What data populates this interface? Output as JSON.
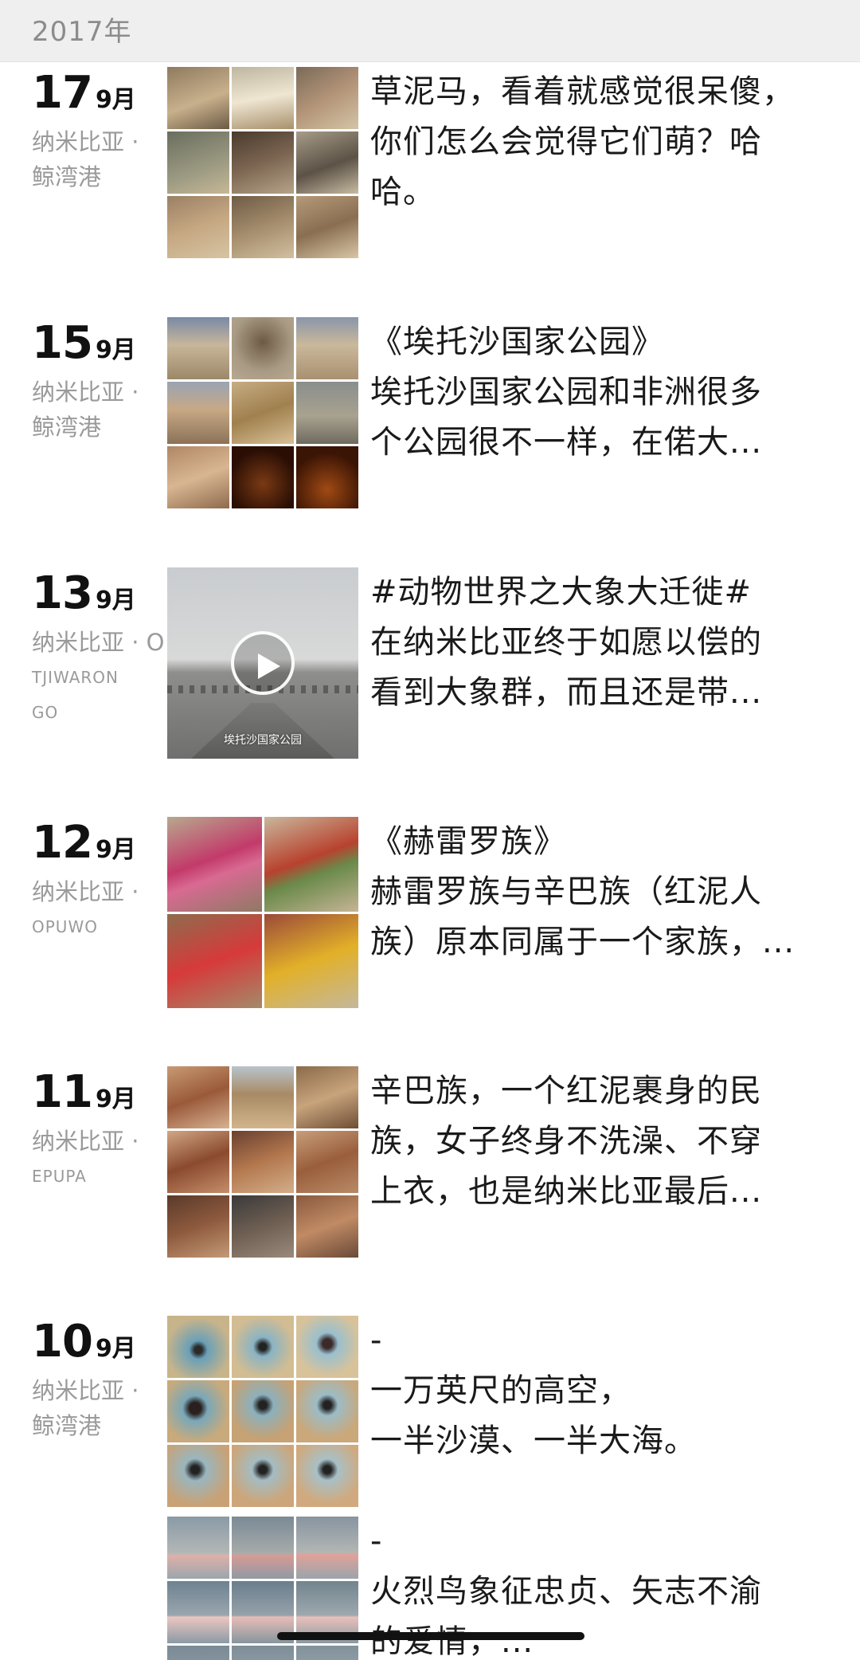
{
  "year_header": "2017年",
  "entries": [
    {
      "day": "17",
      "month": "9月",
      "location": [
        "纳米比亚 ·",
        "鲸湾港"
      ],
      "text": [
        "草泥马，看着就感觉很呆傻，",
        "你们怎么会觉得它们萌？哈",
        "哈。"
      ]
    },
    {
      "day": "15",
      "month": "9月",
      "location": [
        "纳米比亚 ·",
        "鲸湾港"
      ],
      "text": [
        "《埃托沙国家公园》",
        "埃托沙国家公园和非洲很多",
        "个公园很不一样，在偌大..."
      ]
    },
    {
      "day": "13",
      "month": "9月",
      "location": [
        "纳米比亚 · O",
        "TJIWARON",
        "GO"
      ],
      "video_caption": "埃托沙国家公园",
      "text": [
        "#动物世界之大象大迁徙#",
        "在纳米比亚终于如愿以偿的",
        "看到大象群，而且还是带..."
      ]
    },
    {
      "day": "12",
      "month": "9月",
      "location": [
        "纳米比亚 ·",
        "OPUWO"
      ],
      "text": [
        "《赫雷罗族》",
        "赫雷罗族与辛巴族（红泥人",
        "族）原本同属于一个家族，..."
      ]
    },
    {
      "day": "11",
      "month": "9月",
      "location": [
        "纳米比亚 ·",
        "EPUPA"
      ],
      "text": [
        "辛巴族，一个红泥裹身的民",
        "族，女子终身不洗澡、不穿",
        "上衣，也是纳米比亚最后..."
      ]
    },
    {
      "day": "10",
      "month": "9月",
      "location": [
        "纳米比亚 ·",
        "鲸湾港"
      ],
      "text": [
        "-",
        "一万英尺的高空，",
        "一半沙漠、一半大海。"
      ]
    },
    {
      "text": [
        "-",
        "火烈鸟象征忠贞、矢志不渝",
        "的爱情，..."
      ]
    }
  ],
  "colors": {
    "header_bg": "#efefef",
    "meta_text": "#9a9a9a",
    "body_text": "#1a1a1a"
  },
  "icons": {
    "video": "play-icon"
  }
}
